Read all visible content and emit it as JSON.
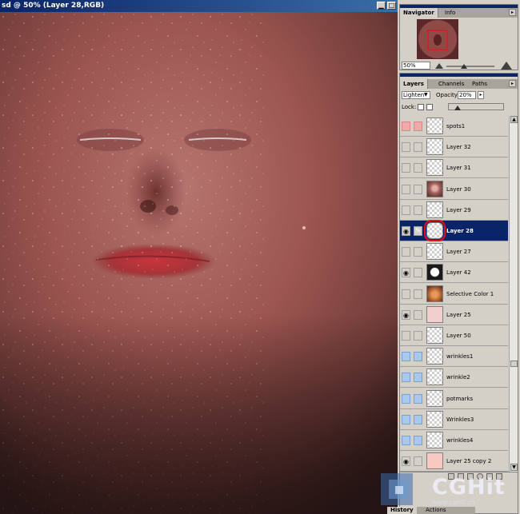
{
  "document": {
    "title": "sd @ 50% (Layer 28,RGB)"
  },
  "navigator": {
    "tabs": [
      {
        "label": "Navigator",
        "active": true
      },
      {
        "label": "Info",
        "active": false
      }
    ],
    "zoom": "50%"
  },
  "layers_panel": {
    "tabs": [
      {
        "label": "Layers",
        "active": true
      },
      {
        "label": "Channels",
        "active": false
      },
      {
        "label": "Paths",
        "active": false
      }
    ],
    "blend_mode": "Lighten",
    "opacity_label": "Opacity:",
    "opacity_value": "20%",
    "lock_label": "Lock:",
    "layers": [
      {
        "name": "spots1",
        "visible": false,
        "color": "pink",
        "thumb": "transparent"
      },
      {
        "name": "Layer 32",
        "visible": false,
        "color": "none",
        "thumb": "transparent"
      },
      {
        "name": "Layer 31",
        "visible": false,
        "color": "none",
        "thumb": "transparent"
      },
      {
        "name": "Layer 30",
        "visible": false,
        "color": "none",
        "thumb": "face"
      },
      {
        "name": "Layer 29",
        "visible": false,
        "color": "none",
        "thumb": "transparent"
      },
      {
        "name": "Layer 28",
        "visible": true,
        "color": "none",
        "thumb": "transparent",
        "selected": true
      },
      {
        "name": "Layer 27",
        "visible": false,
        "color": "none",
        "thumb": "transparent"
      },
      {
        "name": "Layer 42",
        "visible": true,
        "color": "none",
        "thumb": "mask-dark"
      },
      {
        "name": "Selective Color 1",
        "visible": false,
        "color": "none",
        "thumb": "skin"
      },
      {
        "name": "Layer 25",
        "visible": true,
        "color": "none",
        "thumb": "pinkish"
      },
      {
        "name": "Layer 50",
        "visible": false,
        "color": "none",
        "thumb": "transparent"
      },
      {
        "name": "wrinkles1",
        "visible": false,
        "color": "blue",
        "thumb": "transparent"
      },
      {
        "name": "wrinkle2",
        "visible": false,
        "color": "blue",
        "thumb": "transparent"
      },
      {
        "name": "potmarks",
        "visible": false,
        "color": "blue",
        "thumb": "transparent"
      },
      {
        "name": "Wrinkles3",
        "visible": false,
        "color": "blue",
        "thumb": "transparent"
      },
      {
        "name": "wrinkles4",
        "visible": false,
        "color": "blue",
        "thumb": "transparent"
      },
      {
        "name": "Layer 25 copy 2",
        "visible": true,
        "color": "none",
        "thumb": "pinklight"
      }
    ]
  },
  "history_panel": {
    "tabs": [
      {
        "label": "History",
        "active": true
      },
      {
        "label": "Actions",
        "active": false
      }
    ]
  },
  "watermark": {
    "brand": "CGHit",
    "url": "www.cghit.cn"
  },
  "colors": {
    "title_bar": "#0a246a",
    "panel_bg": "#d4d0c8",
    "selection": "#0a246a",
    "highlight_circle": "#e8101a",
    "pink_label": "#f0a8a8",
    "blue_label": "#a8c8ee"
  }
}
